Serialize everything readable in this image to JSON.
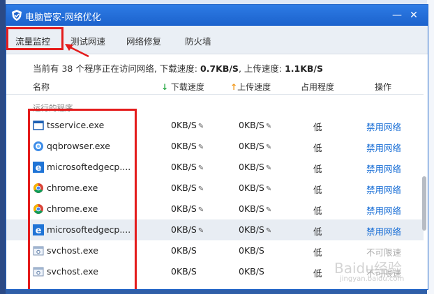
{
  "window": {
    "title": "电脑管家-网络优化",
    "minimize_glyph": "—",
    "close_glyph": "✕"
  },
  "tabs": [
    {
      "label": "流量监控",
      "active": true
    },
    {
      "label": "测试网速"
    },
    {
      "label": "网络修复"
    },
    {
      "label": "防火墙"
    }
  ],
  "summary": {
    "prefix": "当前有 38 个程序正在访问网络, 下载速度: ",
    "download": "0.7KB/S",
    "middle": ", 上传速度: ",
    "upload": "1.1KB/S"
  },
  "columns": {
    "name": "名称",
    "download": "下载速度",
    "upload": "上传速度",
    "usage": "占用程度",
    "action": "操作"
  },
  "group_label": "运行的程序",
  "rows": [
    {
      "icon": "window-app-icon",
      "name": "tsservice.exe",
      "down": "0KB/S",
      "up": "0KB/S",
      "editable": true,
      "usage": "低",
      "action": "禁用网络"
    },
    {
      "icon": "qqbrowser-icon",
      "name": "qqbrowser.exe",
      "down": "0KB/S",
      "up": "0KB/S",
      "editable": true,
      "usage": "低",
      "action": "禁用网络"
    },
    {
      "icon": "edge-icon",
      "name": "microsoftedgecp....",
      "down": "0KB/S",
      "up": "0KB/S",
      "editable": true,
      "usage": "低",
      "action": "禁用网络"
    },
    {
      "icon": "chrome-icon",
      "name": "chrome.exe",
      "down": "0KB/S",
      "up": "0KB/S",
      "editable": true,
      "usage": "低",
      "action": "禁用网络"
    },
    {
      "icon": "chrome-icon",
      "name": "chrome.exe",
      "down": "0KB/S",
      "up": "0KB/S",
      "editable": true,
      "usage": "低",
      "action": "禁用网络"
    },
    {
      "icon": "edge-icon",
      "name": "microsoftedgecp....",
      "down": "0KB/S",
      "up": "0KB/S",
      "editable": true,
      "usage": "低",
      "action": "禁用网络",
      "selected": true
    },
    {
      "icon": "svchost-icon",
      "name": "svchost.exe",
      "down": "0KB/S",
      "up": "0KB/S",
      "editable": false,
      "usage": "低",
      "action": "不可限速"
    },
    {
      "icon": "svchost-icon",
      "name": "svchost.exe",
      "down": "0KB/S",
      "up": "0KB/S",
      "editable": false,
      "usage": "低",
      "action": "不可限速"
    }
  ],
  "watermark": {
    "main": "Baidu经验",
    "sub": "jingyan.baidu.com"
  },
  "colors": {
    "accent": "#1c62cc",
    "link": "#1a6fd6",
    "highlight": "#e41b1b"
  }
}
